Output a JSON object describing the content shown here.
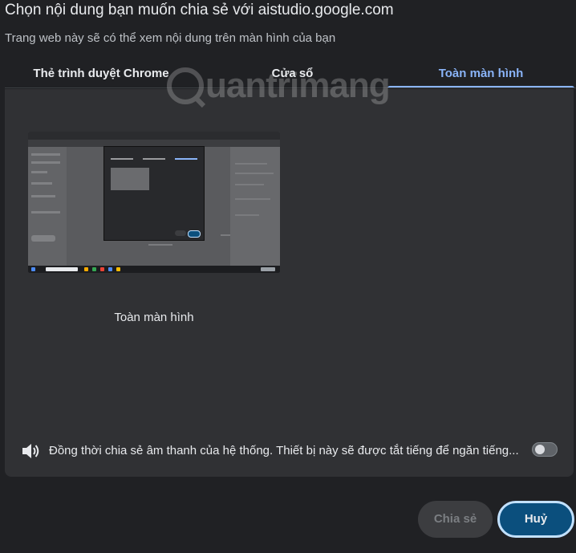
{
  "dialog": {
    "title": "Chọn nội dung bạn muốn chia sẻ với aistudio.google.com",
    "subtitle": "Trang web này sẽ có thể xem nội dung trên màn hình của bạn"
  },
  "watermark": {
    "text": "uantrimang"
  },
  "tabs": [
    {
      "label": "Thẻ trình duyệt Chrome",
      "selected": false
    },
    {
      "label": "Cửa sổ",
      "selected": false
    },
    {
      "label": "Toàn màn hình",
      "selected": true
    }
  ],
  "screens": [
    {
      "label": "Toàn màn hình"
    }
  ],
  "audio": {
    "icon": "speaker-icon",
    "label": "Đồng thời chia sẻ âm thanh của hệ thống. Thiết bị này sẽ được tắt tiếng để ngăn tiếng...",
    "enabled": false
  },
  "buttons": {
    "share": "Chia sẻ",
    "cancel": "Huỷ"
  },
  "colors": {
    "accent": "#8ab4f8",
    "primary_button": "#0b4f7d",
    "background": "#202124",
    "panel": "#303134"
  }
}
